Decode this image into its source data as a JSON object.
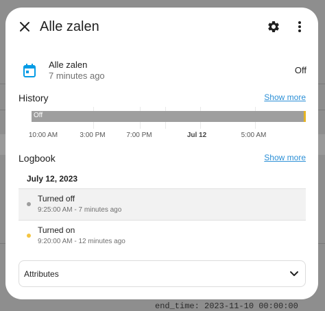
{
  "background": {
    "text": "end_time: 2023-11-10 00:00:00"
  },
  "dialog": {
    "title": "Alle zalen",
    "icons": {
      "close": "close-icon",
      "settings": "gear-icon",
      "menu": "more-vertical-icon"
    }
  },
  "entity": {
    "icon": "calendar-icon",
    "name": "Alle zalen",
    "last_changed": "7 minutes ago",
    "state": "Off"
  },
  "history": {
    "title": "History",
    "show_more": "Show more",
    "timeline": {
      "segments": [
        {
          "state": "Off",
          "fraction": 0.992,
          "color": "#9e9e9e"
        },
        {
          "state": "On",
          "fraction": 0.008,
          "color": "#e6b422"
        }
      ],
      "ticks": [
        "10:00 AM",
        "3:00 PM",
        "7:00 PM",
        "Jul 12",
        "5:00 AM"
      ]
    }
  },
  "logbook": {
    "title": "Logbook",
    "show_more": "Show more",
    "date": "July 12, 2023",
    "entries": [
      {
        "message": "Turned off",
        "when": "9:25:00 AM - 7 minutes ago",
        "dot_color": "#9e9e9e"
      },
      {
        "message": "Turned on",
        "when": "9:20:00 AM - 12 minutes ago",
        "dot_color": "#f4c542"
      }
    ]
  },
  "attributes": {
    "label": "Attributes",
    "icon": "chevron-down-icon"
  },
  "colors": {
    "link": "#2b8fd6",
    "accent": "#039be5"
  }
}
